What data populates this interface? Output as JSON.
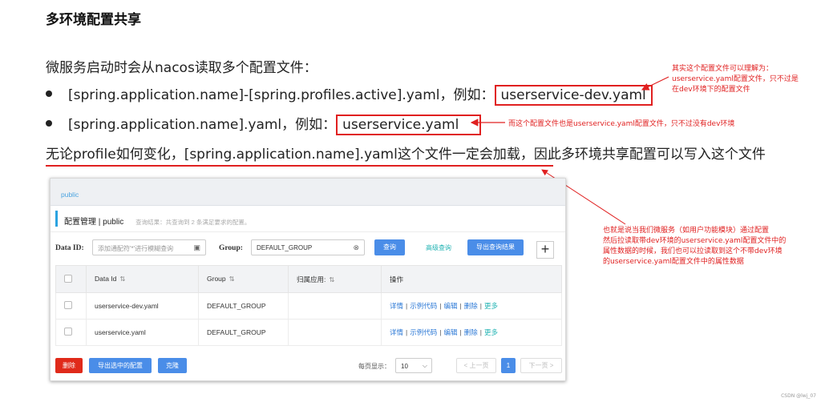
{
  "slide": {
    "title": "多环境配置共享",
    "intro": "微服务启动时会从nacos读取多个配置文件：",
    "bullets": [
      {
        "text": "[spring.application.name]-[spring.profiles.active].yaml，例如：",
        "example": "userservice-dev.yaml"
      },
      {
        "text": "[spring.application.name].yaml，例如：",
        "example": "userservice.yaml"
      }
    ],
    "summary": "无论profile如何变化，[spring.application.name].yaml这个文件一定会加载，因此多环境共享配置可以写入这个文件"
  },
  "annotations": {
    "note1": [
      "其实这个配置文件可以理解为：",
      "userservice.yaml配置文件，只不过是",
      "在dev环境下的配置文件"
    ],
    "note2": "而这个配置文件也是userservice.yaml配置文件，只不过没有dev环境",
    "note3": [
      "也就是说当我们微服务（如用户功能模块）通过配置",
      "然后拉读取带dev环境的userservice.yaml配置文件中的",
      "属性数据的时候，我们也可以拉读取到这个不带dev环境",
      "的userservice.yaml配置文件中的属性数据"
    ]
  },
  "console": {
    "namespace": "public",
    "page_title": "配置管理 | public",
    "hint": "查询结果：共查询到 2 条满足要求的配置。",
    "search": {
      "dataid_label": "Data ID:",
      "dataid_placeholder": "添加通配符'*'进行模糊查询",
      "group_label": "Group:",
      "group_value": "DEFAULT_GROUP",
      "query_btn": "查询",
      "advanced": "高级查询",
      "export": "导出查询结果",
      "add": "+"
    },
    "table": {
      "headers": [
        "Data Id",
        "Group",
        "归属应用:",
        "操作"
      ],
      "rows": [
        {
          "data_id": "userservice-dev.yaml",
          "group": "DEFAULT_GROUP",
          "app": ""
        },
        {
          "data_id": "userservice.yaml",
          "group": "DEFAULT_GROUP",
          "app": ""
        }
      ],
      "ops": {
        "detail": "详情",
        "sample": "示例代码",
        "edit": "编辑",
        "delete": "删除",
        "more": "更多"
      }
    },
    "footer": {
      "delete": "删除",
      "export_selected": "导出选中的配置",
      "clone": "克隆",
      "page_size_label": "每页显示：",
      "page_size": "10",
      "prev": "< 上一页",
      "current_page": "1",
      "next": "下一页 >"
    }
  },
  "watermark": "CSDN @lwj_07",
  "colors": {
    "accent_red": "#e02020",
    "primary": "#4a8de8",
    "danger": "#e02a1a",
    "teal": "#22b3b3"
  }
}
